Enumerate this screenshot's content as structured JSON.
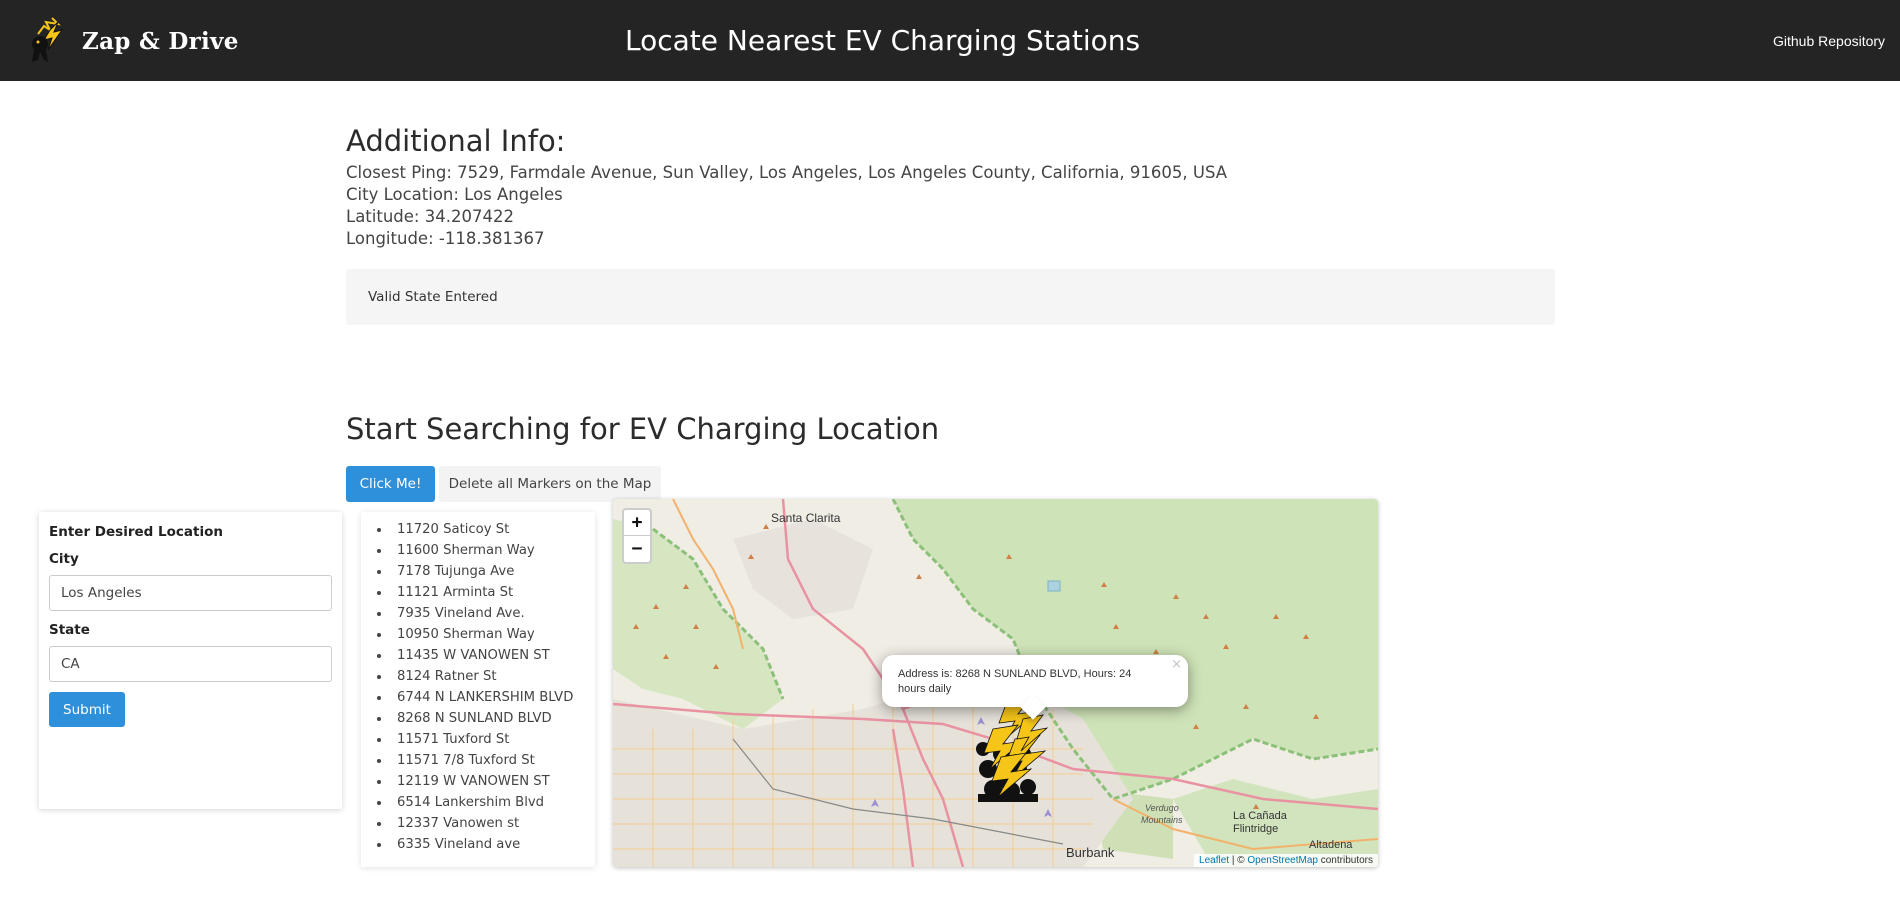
{
  "navbar": {
    "brand": "Zap & Drive",
    "title": "Locate Nearest EV Charging Stations",
    "github_link": "Github Repository"
  },
  "info": {
    "heading": "Additional Info:",
    "closest_ping": "Closest Ping: 7529, Farmdale Avenue, Sun Valley, Los Angeles, Los Angeles County, California, 91605, USA",
    "city_location": "City Location: Los Angeles",
    "latitude": "Latitude: 34.207422",
    "longitude": "Longitude: -118.381367"
  },
  "alert": {
    "message": "Valid State Entered"
  },
  "search": {
    "title": "Start Searching for EV Charging Location",
    "click_me": "Click Me!",
    "delete_markers": "Delete all Markers on the Map"
  },
  "form": {
    "title": "Enter Desired Location",
    "city_label": "City",
    "city_value": "Los Angeles",
    "state_label": "State",
    "state_value": "CA",
    "submit": "Submit"
  },
  "addresses": [
    "11720 Saticoy St",
    "11600 Sherman Way",
    "7178 Tujunga Ave",
    "11121 Arminta St",
    "7935 Vineland Ave.",
    "10950 Sherman Way",
    "11435 W VANOWEN ST",
    "8124 Ratner St",
    "6744 N LANKERSHIM BLVD",
    "8268 N SUNLAND BLVD",
    "11571 Tuxford St",
    "11571 7/8 Tuxford St",
    "12119 W VANOWEN ST",
    "6514 Lankershim Blvd",
    "12337 Vanowen st",
    "6335 Vineland ave"
  ],
  "map": {
    "zoom_in": "+",
    "zoom_out": "−",
    "popup_text": "Address is: 8268 N SUNLAND BLVD, Hours: 24 hours daily",
    "popup_close": "×",
    "attribution_leaflet": "Leaflet",
    "attribution_sep": " | © ",
    "attribution_osm": "OpenStreetMap",
    "attribution_suffix": " contributors",
    "labels": {
      "santa_clarita": "Santa Clarita",
      "burbank": "Burbank",
      "verdugo": "Verdugo",
      "mountains": "Mountains",
      "la_canada": "La Cañada",
      "flintridge": "Flintridge",
      "altadena": "Altadena"
    },
    "colors": {
      "forest": "#cfe3b8",
      "urban": "#e4e0d8",
      "highway": "#e892a2",
      "primary_road": "#f2c893",
      "marker_yellow": "#f5c518"
    }
  }
}
